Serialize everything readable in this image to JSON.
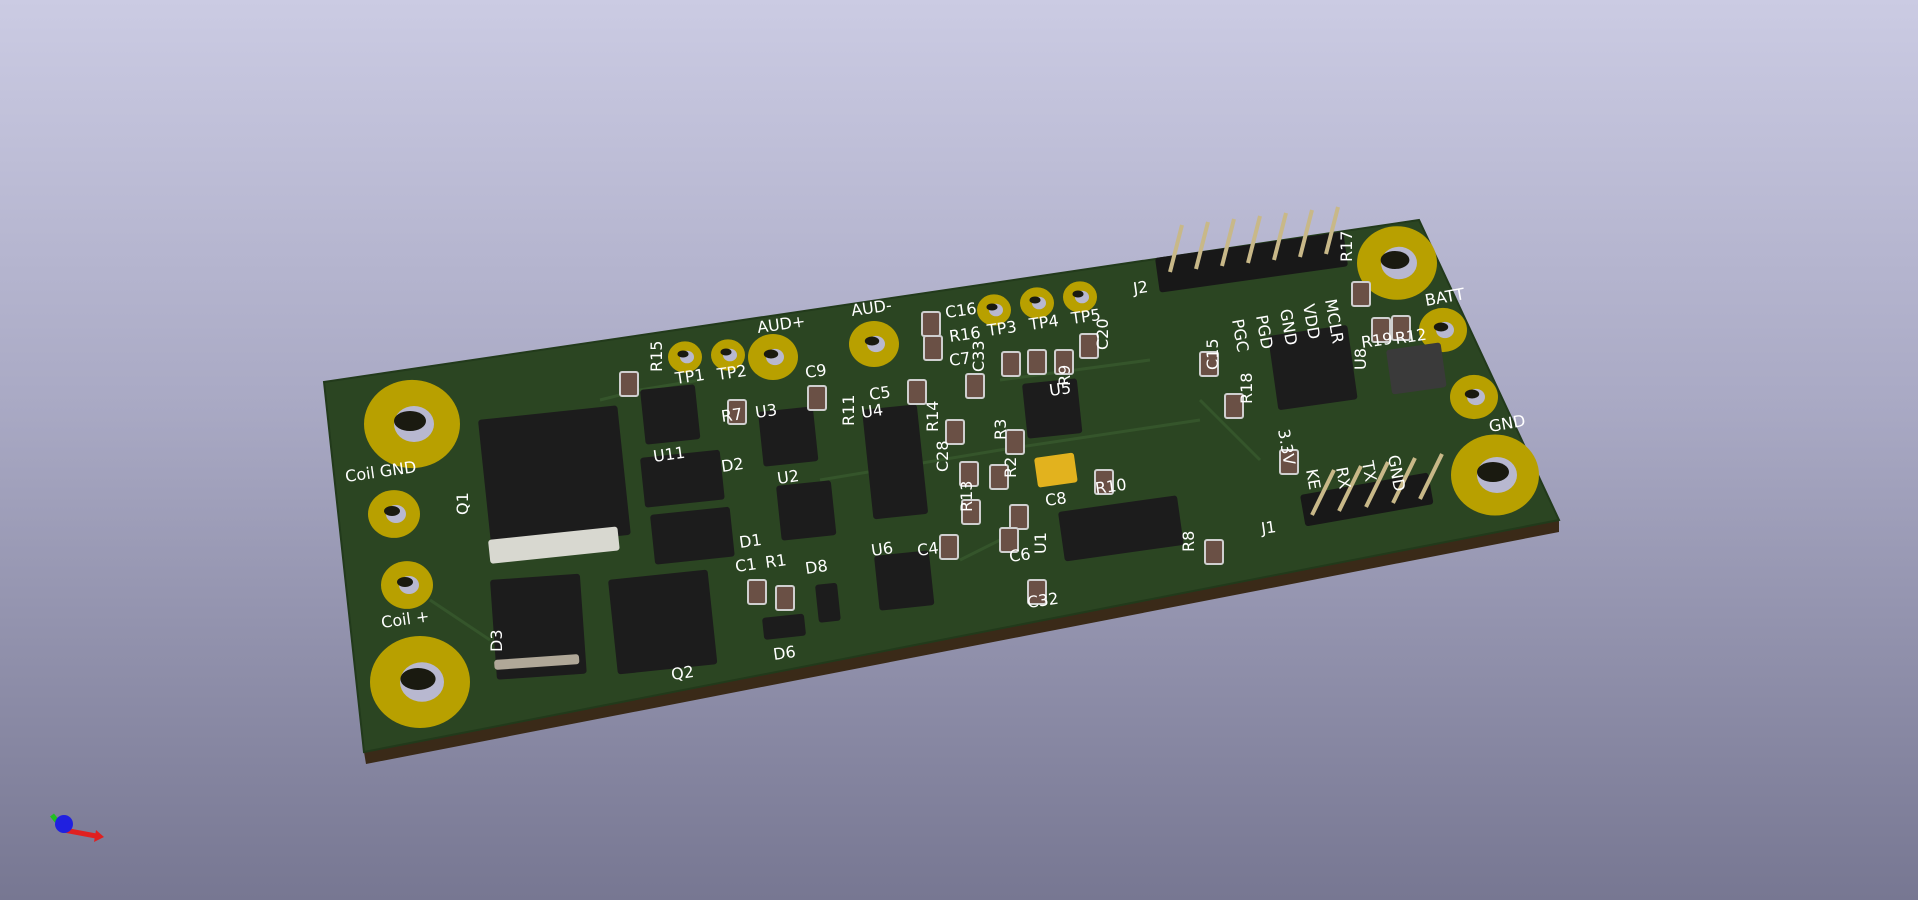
{
  "viewer": {
    "title": "3D Viewer"
  },
  "board": {
    "colors": {
      "soldermask": "#2b4522",
      "copper": "#b8a000",
      "silkscreen": "#ffffff",
      "chip": "#1c1c1c",
      "tantalum": "#e2b21e"
    },
    "edge_labels": {
      "coil_gnd": "Coil GND",
      "coil_plus": "Coil +",
      "aud_plus": "AUD+",
      "aud_minus": "AUD-",
      "batt": "BATT",
      "gnd": "GND"
    },
    "j2_pins": [
      "PGC",
      "PGD",
      "GND",
      "VDD",
      "MCLR"
    ],
    "j1_pins": [
      "3.3V",
      "KE",
      "RX",
      "TX",
      "GND"
    ],
    "refs": [
      "Q1",
      "Q2",
      "D3",
      "D1",
      "D2",
      "D6",
      "D8",
      "C1",
      "R1",
      "U6",
      "C4",
      "C6",
      "C32",
      "U1",
      "R8",
      "R10",
      "C8",
      "R2",
      "R13",
      "C28",
      "R14",
      "R3",
      "R9",
      "C7",
      "C33",
      "C16",
      "R16",
      "C20",
      "C5",
      "C9",
      "R11",
      "U4",
      "U3",
      "R7",
      "R15",
      "U11",
      "U2",
      "TP1",
      "TP2",
      "TP3",
      "TP4",
      "TP5",
      "J2",
      "J1",
      "C15",
      "R18",
      "U8",
      "R19",
      "R12",
      "R17",
      "U5"
    ]
  }
}
